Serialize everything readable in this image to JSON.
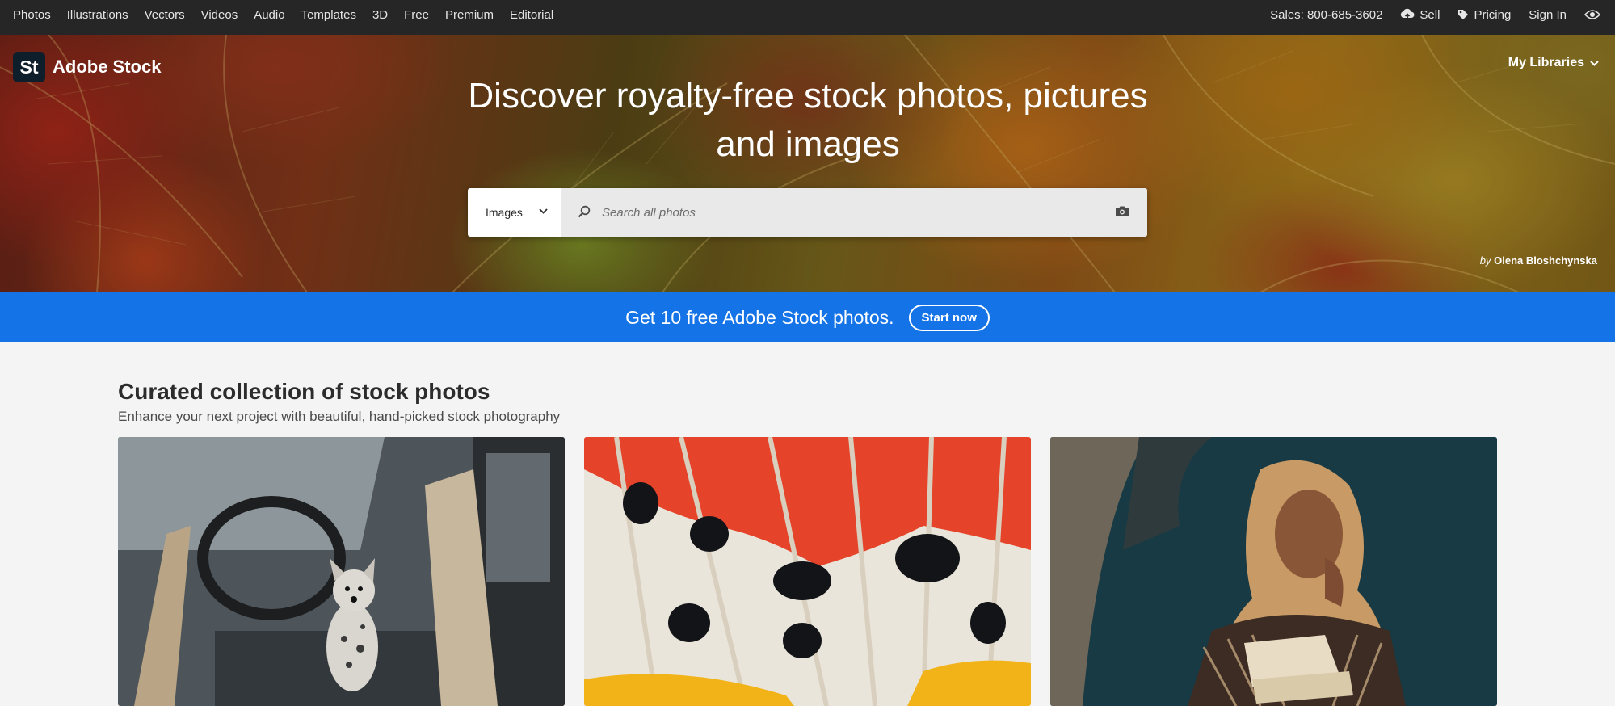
{
  "topnav": {
    "links": [
      "Photos",
      "Illustrations",
      "Vectors",
      "Videos",
      "Audio",
      "Templates",
      "3D",
      "Free",
      "Premium",
      "Editorial"
    ],
    "sales": "Sales: 800-685-3602",
    "sell": "Sell",
    "pricing": "Pricing",
    "sign_in": "Sign In"
  },
  "brand": {
    "mark": "St",
    "name": "Adobe Stock"
  },
  "my_libraries": "My Libraries",
  "hero": {
    "headline_line1": "Discover royalty-free stock photos, pictures",
    "headline_line2": "and images",
    "search_type": "Images",
    "search_placeholder": "Search all photos",
    "credit_by": "by",
    "credit_author": "Olena Bloshchynska"
  },
  "promo": {
    "text": "Get 10 free Adobe Stock photos.",
    "button": "Start now"
  },
  "section": {
    "title": "Curated collection of stock photos",
    "subtitle": "Enhance your next project with beautiful, hand-picked stock photography"
  },
  "colors": {
    "topnav_bg": "#262626",
    "promo_bg": "#1473e6",
    "page_bg": "#f4f4f4"
  },
  "icons": [
    "upload-cloud-icon",
    "tag-icon",
    "eye-icon",
    "chevron-down-icon",
    "search-icon",
    "camera-icon"
  ]
}
